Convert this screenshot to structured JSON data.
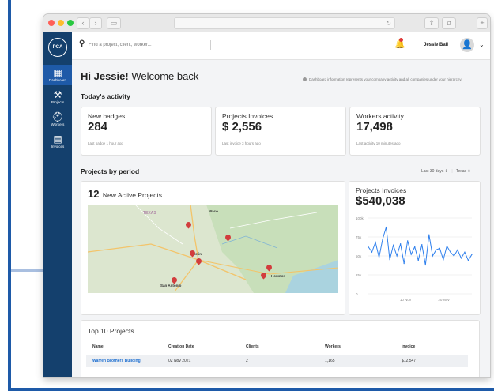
{
  "chrome": {
    "reload": "↻"
  },
  "sidebar": {
    "logo": "PCA",
    "items": [
      {
        "label": "Dashboard",
        "icon": "dashboard-icon",
        "glyph": "▦",
        "active": true
      },
      {
        "label": "Projects",
        "icon": "projects-icon",
        "glyph": "⚒",
        "active": false
      },
      {
        "label": "Workers",
        "icon": "workers-icon",
        "glyph": "⛑",
        "active": false
      },
      {
        "label": "Invoices",
        "icon": "invoices-icon",
        "glyph": "▤",
        "active": false
      }
    ]
  },
  "topbar": {
    "search_placeholder": "Find a project, client, worker...",
    "user_name": "Jessie Ball"
  },
  "header": {
    "greeting_bold": "Hi Jessie!",
    "greeting_rest": " Welcome back",
    "info": "Dashboard information represents your company activity and all companies under your hierarchy."
  },
  "today": {
    "title": "Today's activity",
    "cards": [
      {
        "title": "New badges",
        "value": "284",
        "sub": "Last badge 1 hour ago"
      },
      {
        "title": "Projects Invoices",
        "value": "$ 2,556",
        "sub": "Last invoice 3 hours ago"
      },
      {
        "title": "Workers activity",
        "value": "17,498",
        "sub": "Last activity 10 minutes ago"
      }
    ]
  },
  "period": {
    "title": "Projects by period",
    "range": "Last 30 days",
    "region": "Texas",
    "active_count": "12",
    "active_label": "New Active Projects",
    "map_labels": {
      "state": "TEXAS",
      "waco": "Waco",
      "austin": "Austin",
      "san_antonio": "San Antonio",
      "houston": "Houston"
    },
    "invoices_title": "Projects Invoices",
    "invoices_value": "$540,038"
  },
  "chart_data": {
    "type": "line",
    "title": "Projects Invoices",
    "yticks": [
      "100k",
      "75k",
      "50k",
      "25k",
      "0"
    ],
    "ylim": [
      0,
      100
    ],
    "xticks": [
      "10 Nov",
      "20 Nov"
    ],
    "values": [
      62,
      55,
      68,
      48,
      72,
      88,
      45,
      64,
      50,
      66,
      40,
      70,
      52,
      62,
      44,
      65,
      38,
      78,
      50,
      58,
      60,
      45,
      63,
      55,
      50,
      58,
      47,
      55,
      44,
      52
    ]
  },
  "top_projects": {
    "title": "Top 10 Projects",
    "columns": [
      "Name",
      "Creation Date",
      "Clients",
      "Workers",
      "Invoice"
    ],
    "rows": [
      [
        "Warren Brothers Building",
        "02 Nov 2021",
        "2",
        "1,165",
        "$12,547"
      ]
    ]
  }
}
